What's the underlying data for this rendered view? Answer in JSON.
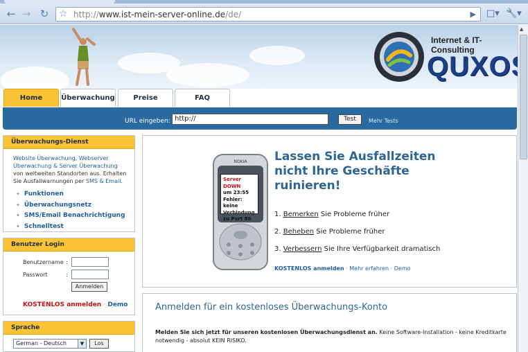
{
  "browser": {
    "url_prefix": "http://",
    "url_host": "www.ist-mein-server-online.de",
    "url_path": "/de/"
  },
  "logo": {
    "tagline": "Internet & IT-Consulting",
    "name": "QUXOS"
  },
  "nav": {
    "tabs": [
      {
        "label": "Home",
        "active": true
      },
      {
        "label": "Überwachung",
        "active": false
      },
      {
        "label": "Preise",
        "active": false
      },
      {
        "label": "FAQ",
        "active": false
      }
    ]
  },
  "urlbar": {
    "label": "URL eingeben:",
    "value": "http://",
    "button": "Test",
    "more": "Mehr Tests"
  },
  "sidebar": {
    "service": {
      "title": "Überwachungs-Dienst",
      "desc_link1": "Website Überwachung",
      "desc_sep": ", ",
      "desc_link2": "Webserver Überwachung & Server Überwachung",
      "desc_mid": " von weltweiten Standorten aus. Erhalten Sie Ausfallwarnungen per ",
      "desc_link3": "SMS & Email",
      "desc_end": ".",
      "links": [
        "Funktionen",
        "Überwachungsnetz",
        "SMS/Email Benachrichtigung",
        "Schnelltest"
      ]
    },
    "login": {
      "title": "Benutzer Login",
      "username_label": "Benutzername",
      "password_label": "Passwort",
      "colon": ":",
      "submit": "Anmelden",
      "free": "KOSTENLOS anmelden",
      "dot": "·",
      "demo": "Demo"
    },
    "language": {
      "title": "Sprache",
      "selected": "German - Deutsch",
      "button": "Los"
    }
  },
  "hero": {
    "phone_brand": "NOKIA",
    "screen_line1": "Server DOWN",
    "screen_line2": "um 23:55",
    "screen_line3": "Fehler: keine",
    "screen_line4": "Verbindung",
    "screen_line5": "zu Port 80",
    "title_line1": "Lassen Sie Ausfallzeiten",
    "title_line2": "nicht Ihre Geschäfte",
    "title_line3": "ruinieren!",
    "steps": [
      {
        "num": "1.",
        "word": "Bemerken",
        "rest": " Sie Probleme früher"
      },
      {
        "num": "2.",
        "word": "Beheben",
        "rest": " Sie Probleme früher"
      },
      {
        "num": "3.",
        "word": "Verbessern",
        "rest": " Sie Ihre Verfügbarkeit dramatisch"
      }
    ],
    "link_free": "KOSTENLOS anmelden",
    "dot": "·",
    "link_more": "Mehr erfahren",
    "link_demo": "Demo"
  },
  "register": {
    "title": "Anmelden für ein kostenloses Überwachungs-Konto",
    "text_bold": "Melden Sie sich jetzt für unseren kostenlosen Überwachungsdienst an.",
    "text_rest": " Keine Software-Installation - keine Kreditkarte notwendig - absolut KEIN RISIKO."
  },
  "colors": {
    "accent_yellow": "#f9c335",
    "bar_blue": "#2b6aa0",
    "link_blue": "#1e5d9c",
    "alert_red": "#cc1111"
  }
}
